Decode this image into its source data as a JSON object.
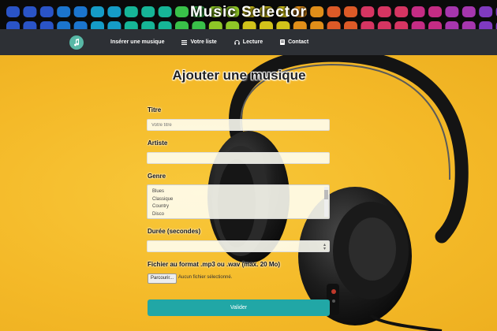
{
  "app": {
    "title": "Music Selector"
  },
  "nav": {
    "items": [
      {
        "label": "Insérer une musique",
        "icon": "none"
      },
      {
        "label": "Votre liste",
        "icon": "list-icon"
      },
      {
        "label": "Lecture",
        "icon": "headphones-icon"
      },
      {
        "label": "Contact",
        "icon": "contact-card-icon"
      }
    ]
  },
  "form": {
    "heading": "Ajouter une musique",
    "title_label": "Titre",
    "title_placeholder": "Votre titre",
    "artist_label": "Artiste",
    "artist_value": "",
    "genre_label": "Genre",
    "genre_options": [
      "Blues",
      "Classique",
      "Country",
      "Disco"
    ],
    "duration_label": "Durée (secondes)",
    "duration_value": "",
    "file_label": "Fichier au format .mp3 ou .wav (max. 20 Mo)",
    "file_button": "Parcourir...",
    "file_status": "Aucun fichier sélectionné.",
    "submit_label": "Valider"
  },
  "colors": {
    "nav_bg": "#2d3035",
    "accent": "#21a7a6",
    "logo": "#58b8a6",
    "background": "#f6c12e"
  }
}
